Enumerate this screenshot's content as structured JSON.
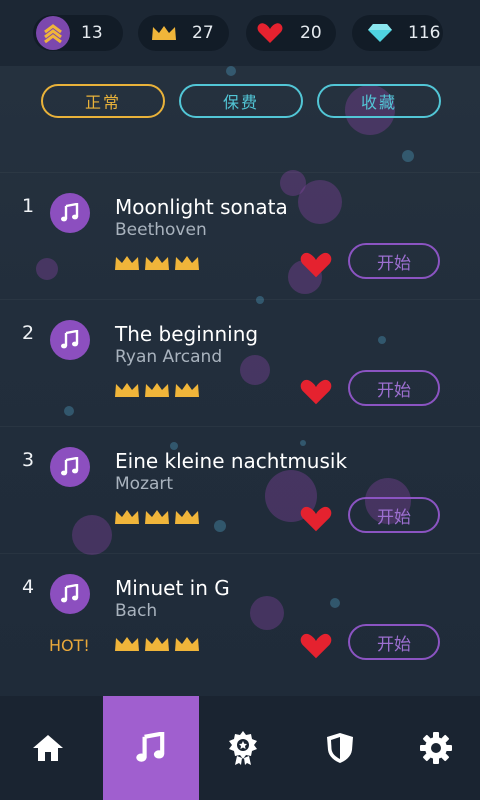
{
  "stats": {
    "rank": "13",
    "crowns": "27",
    "lives": "20",
    "diamonds": "116"
  },
  "tabs": [
    {
      "label": "正常",
      "active": true
    },
    {
      "label": "保费",
      "active": false
    },
    {
      "label": "收藏",
      "active": false
    }
  ],
  "songs": [
    {
      "index": "1",
      "title": "Moonlight sonata",
      "artist": "Beethoven",
      "crowns": 3,
      "hot": "",
      "start_label": "开始"
    },
    {
      "index": "2",
      "title": "The beginning",
      "artist": "Ryan Arcand",
      "crowns": 3,
      "hot": "",
      "start_label": "开始"
    },
    {
      "index": "3",
      "title": "Eine kleine nachtmusik",
      "artist": "Mozart",
      "crowns": 3,
      "hot": "",
      "start_label": "开始"
    },
    {
      "index": "4",
      "title": "Minuet in G",
      "artist": "Bach",
      "crowns": 3,
      "hot": "HOT!",
      "start_label": "开始"
    }
  ],
  "nav": [
    {
      "icon": "home-icon",
      "active": false
    },
    {
      "icon": "music-note-icon",
      "active": true
    },
    {
      "icon": "award-badge-icon",
      "active": false
    },
    {
      "icon": "shield-icon",
      "active": false
    },
    {
      "icon": "gear-icon",
      "active": false
    }
  ],
  "colors": {
    "accent_purple": "#a05fcf",
    "gold": "#e9b23a",
    "cyan": "#52c6d6",
    "heart_red": "#e5222f"
  }
}
